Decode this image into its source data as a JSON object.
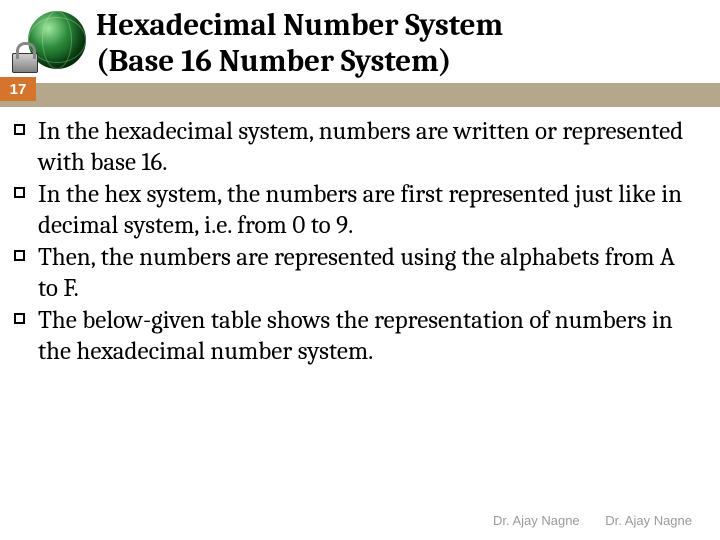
{
  "header": {
    "title_line1": "Hexadecimal Number System",
    "title_line2": "(Base 16 Number System)",
    "icon": "globe-lock-icon"
  },
  "page_number": "17",
  "bullets": [
    "In the hexadecimal system, numbers are written or represented with base 16.",
    "In the hex system, the numbers are first represented just like in decimal system, i.e. from 0 to 9.",
    "Then, the numbers are represented using the alphabets from A to F.",
    "The below-given table shows the representation of numbers in the hexadecimal number system."
  ],
  "footer": {
    "author1": "Dr. Ajay Nagne",
    "author2": "Dr. Ajay Nagne"
  }
}
